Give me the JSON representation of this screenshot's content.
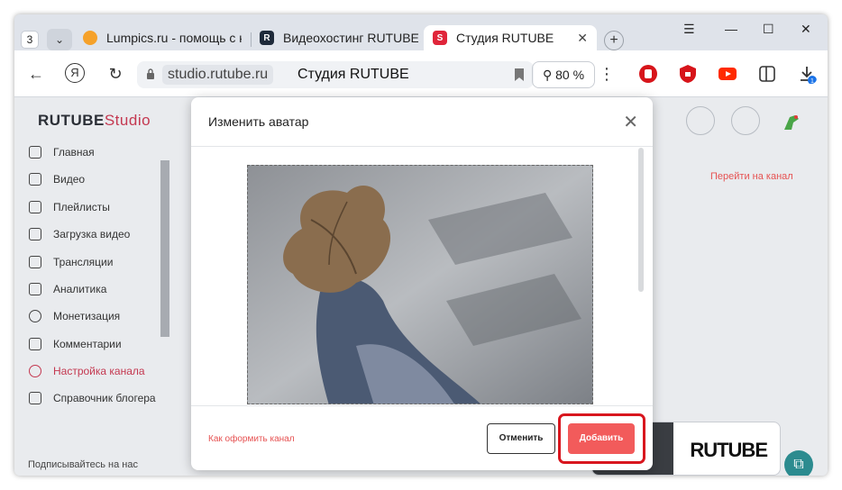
{
  "tabstrip": {
    "tab_count": "3",
    "tabs": [
      {
        "label": "Lumpics.ru - помощь с кс",
        "favicon_color": "#f5a12a"
      },
      {
        "label": "Видеохостинг RUTUBE.",
        "favicon_color": "#1e2a3a"
      },
      {
        "label": "Студия RUTUBE",
        "favicon_color": "#e0253a"
      }
    ],
    "new_tab": "+",
    "window_controls": {
      "menu": "☰",
      "minimize": "—",
      "maximize": "☐",
      "close": "✕"
    }
  },
  "toolbar": {
    "back": "←",
    "yandex": "Я",
    "reload": "↻",
    "domain": "studio.rutube.ru",
    "page_title": "Студия RUTUBE",
    "zoom": "⚲ 80 %",
    "more": "⋮",
    "download_badge": "1"
  },
  "studio": {
    "logo_main": "RUTUBE",
    "logo_studio": "Studio",
    "sidebar": [
      {
        "label": "Главная"
      },
      {
        "label": "Видео"
      },
      {
        "label": "Плейлисты"
      },
      {
        "label": "Загрузка видео"
      },
      {
        "label": "Трансляции"
      },
      {
        "label": "Аналитика"
      },
      {
        "label": "Монетизация"
      },
      {
        "label": "Комментарии"
      },
      {
        "label": "Настройка канала"
      },
      {
        "label": "Справочник блогера"
      }
    ],
    "subscribe": "Подписывайтесь на нас",
    "goto_channel": "Перейти на канал",
    "promo_text": "RUTUBE"
  },
  "modal": {
    "title": "Изменить аватар",
    "link": "Как оформить канал",
    "cancel": "Отменить",
    "add": "Добавить"
  },
  "colors": {
    "accent": "#e65252",
    "add_button": "#f25b5b",
    "highlight": "#d8161e",
    "active_nav": "#c43850"
  }
}
